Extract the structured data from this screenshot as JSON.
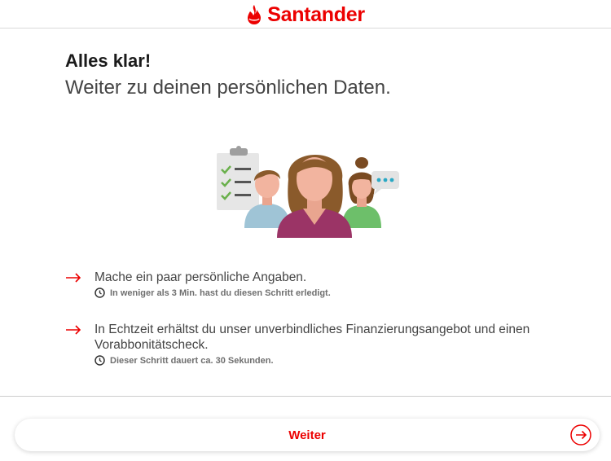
{
  "header": {
    "brand_name": "Santander",
    "brand_color": "#ec0000"
  },
  "main": {
    "title": "Alles klar!",
    "subtitle": "Weiter zu deinen persönlichen Daten.",
    "illustration": {
      "icon": "people-checklist-illustration"
    },
    "steps": [
      {
        "text": "Mache ein paar persönliche Angaben.",
        "note": "In weniger als 3 Min. hast du diesen Schritt erledigt.",
        "arrow_icon": "arrow-right-icon",
        "note_icon": "clock-icon"
      },
      {
        "text": "In Echtzeit erhältst du unser unverbindliches Finanzierungsangebot und einen Vorabbonitätscheck.",
        "note": "Dieser Schritt dauert ca. 30 Sekunden.",
        "arrow_icon": "arrow-right-icon",
        "note_icon": "clock-icon"
      }
    ]
  },
  "footer": {
    "continue_label": "Weiter",
    "continue_icon": "circle-arrow-right-icon"
  }
}
